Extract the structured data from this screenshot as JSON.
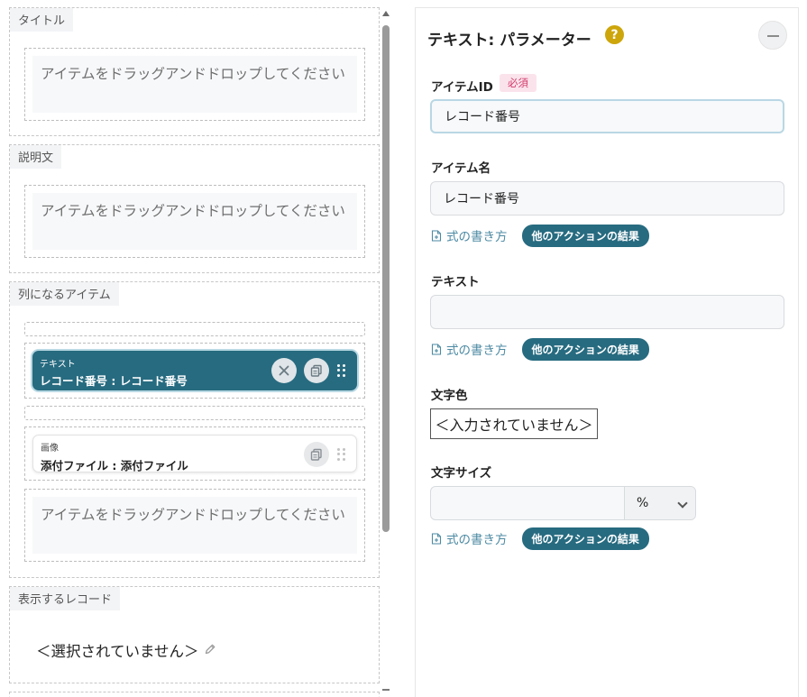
{
  "left": {
    "sections": {
      "title": {
        "label": "タイトル"
      },
      "description": {
        "label": "説明文"
      },
      "list_items": {
        "label": "列になるアイテム"
      },
      "record": {
        "label": "表示するレコード",
        "value": "＜選択されていません＞"
      }
    },
    "drop_placeholder": "アイテムをドラッグアンドドロップしてください",
    "items": [
      {
        "type": "テキスト",
        "name": "レコード番号 : レコード番号",
        "selected": true
      },
      {
        "type": "画像",
        "name": "添付ファイル : 添付ファイル",
        "selected": false
      }
    ]
  },
  "panel": {
    "title": "テキスト: パラメーター",
    "help_glyph": "?",
    "fields": {
      "item_id": {
        "label": "アイテムID",
        "required_badge": "必須",
        "value": "レコード番号"
      },
      "item_name": {
        "label": "アイテム名",
        "value": "レコード番号"
      },
      "text": {
        "label": "テキスト",
        "value": ""
      },
      "text_color": {
        "label": "文字色",
        "value": "＜入力されていません＞"
      },
      "text_size": {
        "label": "文字サイズ",
        "value": "",
        "unit": "%"
      }
    },
    "helper": {
      "howto": "式の書き方",
      "other_results": "他のアクションの結果"
    }
  },
  "colors": {
    "accent": "#276b80",
    "link": "#4c8aa3",
    "help": "#cda60c",
    "required_bg": "#fbe3ec",
    "required_fg": "#d23a6a"
  }
}
